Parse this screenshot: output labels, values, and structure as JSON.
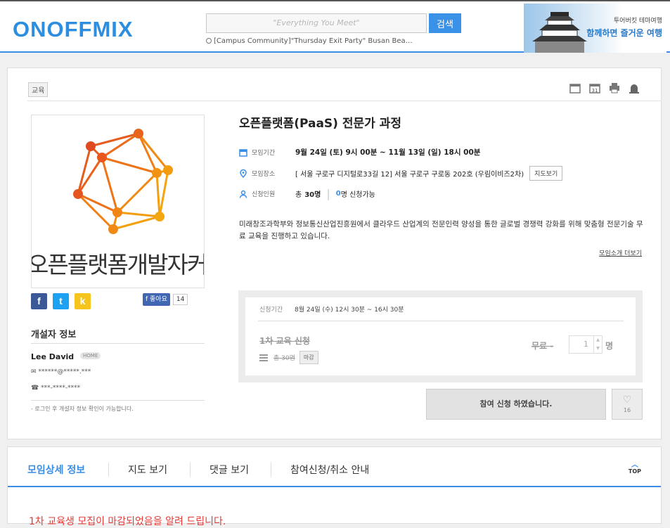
{
  "header": {
    "logo": "ONOFFMIX",
    "search_placeholder": "\"Everything You Meet\"",
    "search_button": "검색",
    "search_hint": "[Campus Community]\"Thursday Exit Party\" Busan Bea…",
    "ad_line1": "투어버킷 테마여행",
    "ad_line2": "함께하면 즐거운 여행"
  },
  "event": {
    "category": "교육",
    "thumbnail_text": "오픈플랫폼개발자커뮤",
    "title": "오픈플랫폼(PaaS) 전문가 과정",
    "period_label": "모임기간",
    "period_value": "9월 24일 (토) 9시 00분 ~ 11월 13일 (일) 18시 00분",
    "place_label": "모임장소",
    "place_value": "[ 서울 구로구 디지털로33길 12] 서울 구로구 구로동 202호 (우림이비즈2차)",
    "map_button": "지도보기",
    "capacity_label": "신청인원",
    "capacity_total_prefix": "총",
    "capacity_total": "30명",
    "capacity_available_count": "0",
    "capacity_available_suffix": "명 신청가능",
    "description": "미래창조과학부와 정보통신산업진흥원에서 클라우드 산업계의 전문인력 양성을 통한 글로벌 경쟁력 강화를 위해 맞춤형 전문기술 무료 교육을 진행하고 있습니다.",
    "more_link": "모임소개 더보기"
  },
  "share": {
    "facebook": "f",
    "twitter": "t",
    "kakao": "k",
    "like_label": "좋아요",
    "like_count": "14"
  },
  "host": {
    "section_title": "개설자 정보",
    "name": "Lee David",
    "home_badge": "HOME",
    "email": "******@*****.***",
    "phone": "***-****-****",
    "note": "- 로그인 후 개설자 정보 확인이 가능합니다."
  },
  "registration": {
    "period_label": "신청기간",
    "period_value": "8월 24일 (수) 12시 30분 ~ 16시 30분",
    "session_name": "1차 교육 신청",
    "total": "총 30명",
    "closed_badge": "마감",
    "price": "무료 -",
    "quantity": "1",
    "unit": "명",
    "apply_button": "참여 신청 하였습니다.",
    "like_count": "16"
  },
  "tabs": {
    "items": [
      "모임상세 정보",
      "지도 보기",
      "댓글 보기",
      "참여신청/취소 안내"
    ],
    "top_label": "TOP"
  },
  "notice": "1차 교육생 모집이 마감되었음을 알려 드립니다."
}
